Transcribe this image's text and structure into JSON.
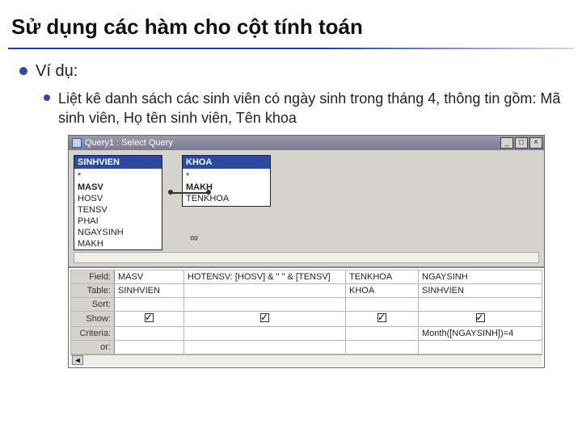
{
  "title": "Sử dụng các hàm cho cột tính toán",
  "bullet_main": "Ví dụ:",
  "bullet_sub": "Liệt kê danh sách các sinh viên có ngày sinh trong tháng 4, thông tin gồm: Mã sinh viên, Họ tên sinh viên, Tên khoa",
  "window": {
    "title": "Query1 : Select Query",
    "min": "_",
    "max": "□",
    "close": "×"
  },
  "tables": {
    "t1": {
      "name": "SINHVIEN",
      "fields": [
        "*",
        "MASV",
        "HOSV",
        "TENSV",
        "PHAI",
        "NGAYSINH",
        "MAKH"
      ]
    },
    "t2": {
      "name": "KHOA",
      "fields": [
        "*",
        "MAKH",
        "TENKHOA"
      ]
    }
  },
  "grid": {
    "rowFields": "Field:",
    "rowTable": "Table:",
    "rowSort": "Sort:",
    "rowShow": "Show:",
    "rowCriteria": "Criteria:",
    "rowOr": "or:",
    "cols": [
      {
        "field": "MASV",
        "table": "SINHVIEN",
        "show": true,
        "criteria": ""
      },
      {
        "field": "HOTENSV: [HOSV] & \" \" & [TENSV]",
        "table": "",
        "show": true,
        "criteria": ""
      },
      {
        "field": "TENKHOA",
        "table": "KHOA",
        "show": true,
        "criteria": ""
      },
      {
        "field": "NGAYSINH",
        "table": "SINHVIEN",
        "show": true,
        "criteria": "Month([NGAYSINH])=4"
      }
    ]
  },
  "infinity": "∞"
}
